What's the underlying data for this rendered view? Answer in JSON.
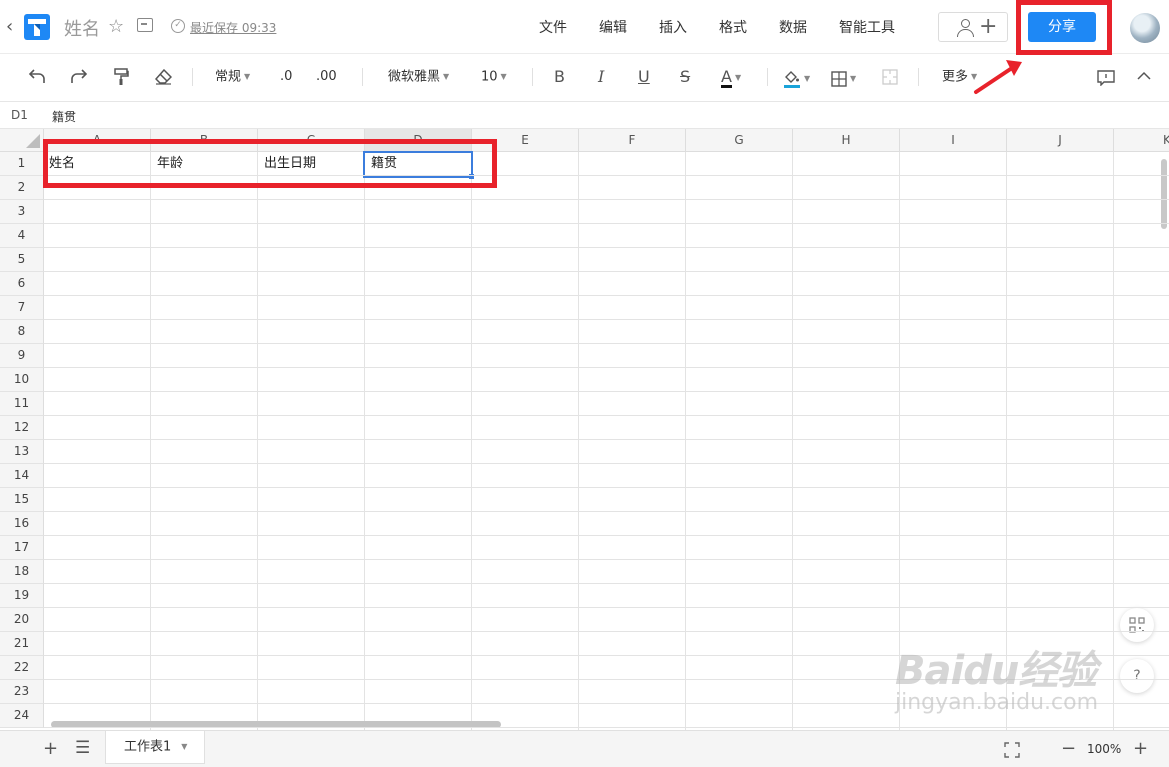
{
  "header": {
    "title": "姓名",
    "save_status": "最近保存 09:33",
    "menus": [
      "文件",
      "编辑",
      "插入",
      "格式",
      "数据",
      "智能工具"
    ],
    "share_label": "分享",
    "accent_color": "#1e88f5"
  },
  "toolbar": {
    "number_format": "常规",
    "decrease_decimal": ".0",
    "increase_decimal": ".00",
    "font_family": "微软雅黑",
    "font_size": "10",
    "bold": "B",
    "italic": "I",
    "underline": "U",
    "strike": "S",
    "font_color_glyph": "A",
    "more_label": "更多"
  },
  "formula_bar": {
    "cell_ref": "D1",
    "value": "籍贯"
  },
  "grid": {
    "columns": [
      "A",
      "B",
      "C",
      "D",
      "E",
      "F",
      "G",
      "H",
      "I",
      "J",
      "K"
    ],
    "selected_column": "D",
    "row_numbers": [
      "1",
      "2",
      "3",
      "4",
      "5",
      "6",
      "7",
      "8",
      "9",
      "10",
      "11",
      "12",
      "13",
      "14",
      "15",
      "16",
      "17",
      "18",
      "19",
      "20",
      "21",
      "22",
      "23",
      "24"
    ],
    "row1": [
      "姓名",
      "年龄",
      "出生日期",
      "籍贯"
    ],
    "selected_cell": "D1"
  },
  "float_buttons": {
    "help": "?"
  },
  "footer": {
    "sheet_name": "工作表1",
    "zoom": "100%"
  },
  "watermark": {
    "brand": "Baidu经验",
    "url": "jingyan.baidu.com"
  }
}
